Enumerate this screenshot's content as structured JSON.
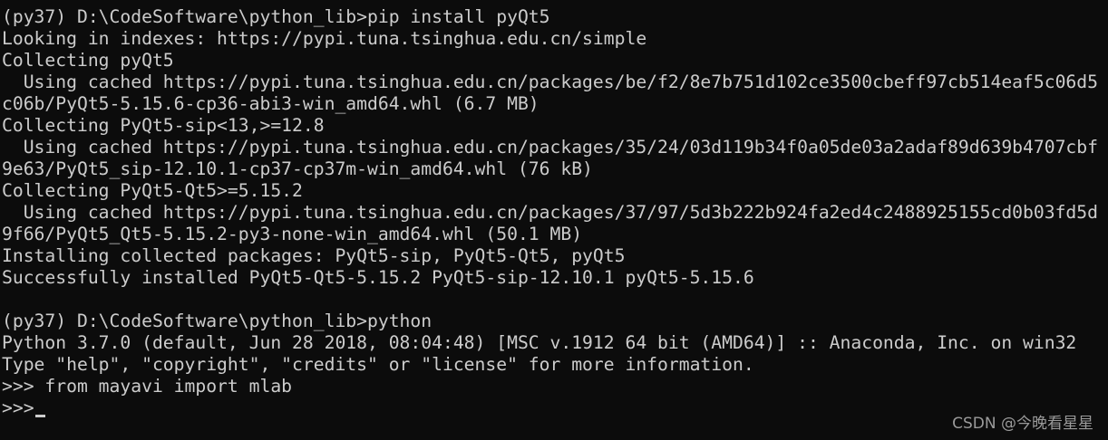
{
  "terminal": {
    "lines": [
      "(py37) D:\\CodeSoftware\\python_lib>pip install pyQt5",
      "Looking in indexes: https://pypi.tuna.tsinghua.edu.cn/simple",
      "Collecting pyQt5",
      "  Using cached https://pypi.tuna.tsinghua.edu.cn/packages/be/f2/8e7b751d102ce3500cbeff97cb514eaf5c06d5",
      "c06b/PyQt5-5.15.6-cp36-abi3-win_amd64.whl (6.7 MB)",
      "Collecting PyQt5-sip<13,>=12.8",
      "  Using cached https://pypi.tuna.tsinghua.edu.cn/packages/35/24/03d119b34f0a05de03a2adaf89d639b4707cbf",
      "9e63/PyQt5_sip-12.10.1-cp37-cp37m-win_amd64.whl (76 kB)",
      "Collecting PyQt5-Qt5>=5.15.2",
      "  Using cached https://pypi.tuna.tsinghua.edu.cn/packages/37/97/5d3b222b924fa2ed4c2488925155cd0b03fd5d",
      "9f66/PyQt5_Qt5-5.15.2-py3-none-win_amd64.whl (50.1 MB)",
      "Installing collected packages: PyQt5-sip, PyQt5-Qt5, pyQt5",
      "Successfully installed PyQt5-Qt5-5.15.2 PyQt5-sip-12.10.1 pyQt5-5.15.6",
      "",
      "(py37) D:\\CodeSoftware\\python_lib>python",
      "Python 3.7.0 (default, Jun 28 2018, 08:04:48) [MSC v.1912 64 bit (AMD64)] :: Anaconda, Inc. on win32",
      "Type \"help\", \"copyright\", \"credits\" or \"license\" for more information.",
      ">>> from mayavi import mlab",
      ">>>"
    ]
  },
  "watermark": "CSDN @今晚看星星"
}
